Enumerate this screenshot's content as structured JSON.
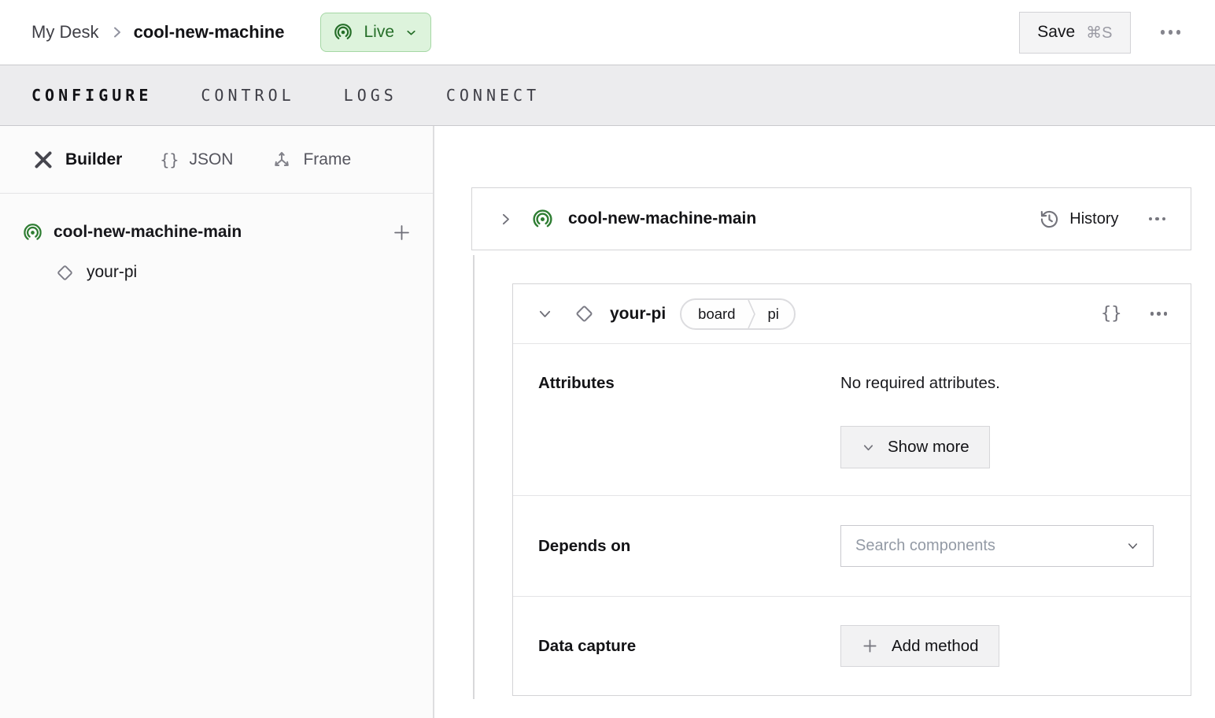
{
  "topbar": {
    "breadcrumb": {
      "parent": "My Desk",
      "current": "cool-new-machine"
    },
    "live_badge": {
      "label": "Live"
    },
    "save_button": {
      "label": "Save",
      "shortcut": "⌘S"
    }
  },
  "nav_tabs": {
    "configure": "CONFIGURE",
    "control": "CONTROL",
    "logs": "LOGS",
    "connect": "CONNECT"
  },
  "sidebar": {
    "view_tabs": {
      "builder": "Builder",
      "json": "JSON",
      "frame": "Frame"
    },
    "tree": {
      "machine_label": "cool-new-machine-main",
      "component_label": "your-pi"
    }
  },
  "main": {
    "machine_card": {
      "title": "cool-new-machine-main",
      "history_label": "History"
    },
    "component_card": {
      "title": "your-pi",
      "type": "board",
      "model": "pi",
      "attributes": {
        "label": "Attributes",
        "empty_text": "No required attributes.",
        "show_more": "Show more"
      },
      "depends_on": {
        "label": "Depends on",
        "placeholder": "Search components"
      },
      "data_capture": {
        "label": "Data capture",
        "add_method": "Add method"
      }
    }
  },
  "icons": {
    "braces_glyph": "{}",
    "live": "broadcast-icon",
    "builder": "tools-icon",
    "json": "braces-icon",
    "frame": "frame-axes-icon",
    "component": "diamond-icon",
    "history": "history-icon",
    "overflow": "ellipsis-icon"
  },
  "colors": {
    "live_bg": "#ddf3dc",
    "live_border": "#a5d7a4",
    "live_text": "#256e28",
    "brand_green": "#2e7d32",
    "tabstrip_bg": "#ececee"
  }
}
